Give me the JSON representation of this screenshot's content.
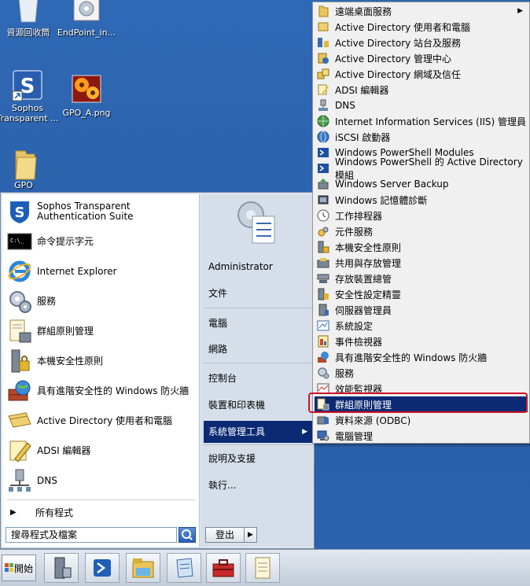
{
  "desktop": {
    "icons": [
      {
        "label": "資源回收筒"
      },
      {
        "label": "EndPoint_in..."
      },
      {
        "label": "Sophos Transparent ..."
      },
      {
        "label": "GPO_A.png"
      },
      {
        "label": "GPO"
      }
    ]
  },
  "start_menu": {
    "pinned": [
      {
        "label": "Sophos Transparent Authentication Suite"
      },
      {
        "label": "命令提示字元"
      },
      {
        "label": "Internet Explorer"
      },
      {
        "label": "服務"
      },
      {
        "label": "群組原則管理"
      },
      {
        "label": "本機安全性原則"
      },
      {
        "label": "具有進階安全性的 Windows 防火牆"
      },
      {
        "label": "Active Directory 使用者和電腦"
      },
      {
        "label": "ADSI 編輯器"
      },
      {
        "label": "DNS"
      }
    ],
    "all_programs": "所有程式",
    "search_placeholder": "搜尋程式及檔案",
    "right": {
      "user": "Administrator",
      "documents": "文件",
      "computer": "電腦",
      "network": "網路",
      "control_panel": "控制台",
      "devices": "裝置和印表機",
      "admin_tools": "系統管理工具",
      "help": "說明及支援",
      "run": "執行...",
      "logout": "登出"
    }
  },
  "admin_tools_menu": {
    "items": [
      {
        "label": "遠端桌面服務"
      },
      {
        "label": "Active Directory 使用者和電腦"
      },
      {
        "label": "Active Directory 站台及服務"
      },
      {
        "label": "Active Directory 管理中心"
      },
      {
        "label": "Active Directory 網域及信任"
      },
      {
        "label": "ADSI 編輯器"
      },
      {
        "label": "DNS"
      },
      {
        "label": "Internet Information Services (IIS) 管理員"
      },
      {
        "label": "iSCSI 啟動器"
      },
      {
        "label": "Windows PowerShell Modules"
      },
      {
        "label": "Windows PowerShell 的 Active Directory 模組"
      },
      {
        "label": "Windows Server Backup"
      },
      {
        "label": "Windows 記憶體診斷"
      },
      {
        "label": "工作排程器"
      },
      {
        "label": "元件服務"
      },
      {
        "label": "本機安全性原則"
      },
      {
        "label": "共用與存放管理"
      },
      {
        "label": "存放裝置總管"
      },
      {
        "label": "安全性設定精靈"
      },
      {
        "label": "伺服器管理員"
      },
      {
        "label": "系統設定"
      },
      {
        "label": "事件檢視器"
      },
      {
        "label": "具有進階安全性的 Windows 防火牆"
      },
      {
        "label": "服務"
      },
      {
        "label": "效能監視器"
      },
      {
        "label": "群組原則管理"
      },
      {
        "label": "資料來源 (ODBC)"
      },
      {
        "label": "電腦管理"
      }
    ],
    "highlighted_index": 25,
    "highlight_border_color": "#d0142a"
  },
  "taskbar": {
    "start_label": "開始"
  }
}
